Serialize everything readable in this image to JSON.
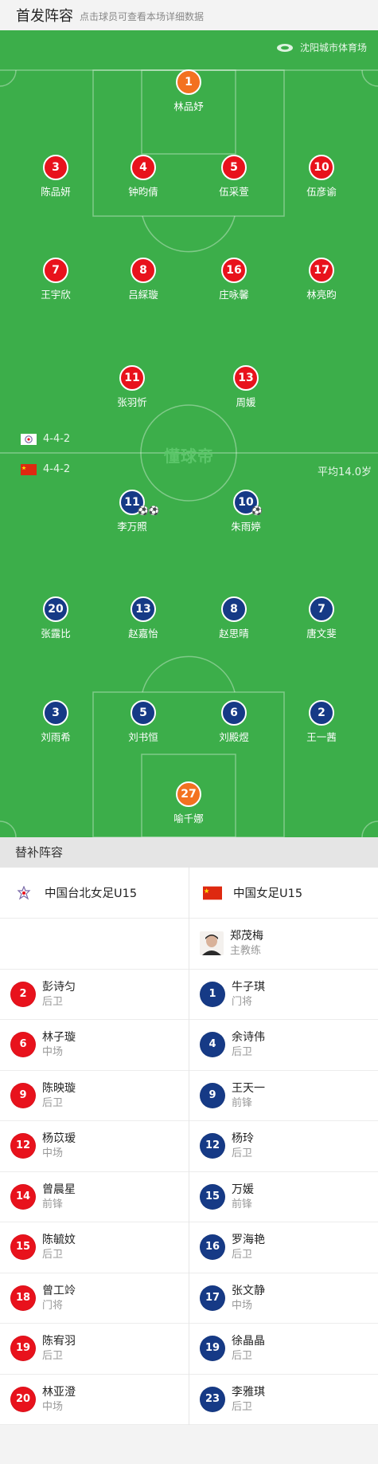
{
  "header": {
    "title": "首发阵容",
    "hint": "点击球员可查看本场详细数据"
  },
  "pitch": {
    "stadium": "沈阳城市体育场",
    "watermark": "懂球帝",
    "home_formation": "4-4-2",
    "away_formation": "4-4-2",
    "avg_age": "平均14.0岁"
  },
  "home_lineup": [
    {
      "number": "1",
      "name": "林品妤"
    },
    {
      "number": "3",
      "name": "陈品妍"
    },
    {
      "number": "4",
      "name": "钟昀倩"
    },
    {
      "number": "5",
      "name": "伍采萱"
    },
    {
      "number": "10",
      "name": "伍彦谕"
    },
    {
      "number": "7",
      "name": "王宇欣"
    },
    {
      "number": "8",
      "name": "吕綵璇"
    },
    {
      "number": "16",
      "name": "庄咏馨"
    },
    {
      "number": "17",
      "name": "林亮昀"
    },
    {
      "number": "11",
      "name": "张羽忻"
    },
    {
      "number": "13",
      "name": "周媛"
    }
  ],
  "away_lineup": [
    {
      "number": "11",
      "name": "李万照",
      "goals": "⚽⚽"
    },
    {
      "number": "10",
      "name": "朱雨婷",
      "goals": "⚽"
    },
    {
      "number": "20",
      "name": "张露比"
    },
    {
      "number": "13",
      "name": "赵嘉怡"
    },
    {
      "number": "8",
      "name": "赵思晴"
    },
    {
      "number": "7",
      "name": "唐文斐"
    },
    {
      "number": "3",
      "name": "刘雨希"
    },
    {
      "number": "5",
      "name": "刘书恒"
    },
    {
      "number": "6",
      "name": "刘殿煜"
    },
    {
      "number": "2",
      "name": "王一茜"
    },
    {
      "number": "27",
      "name": "喻千娜"
    }
  ],
  "subs": {
    "title": "替补阵容",
    "home_team": "中国台北女足U15",
    "away_team": "中国女足U15",
    "coach": {
      "name": "郑茂梅",
      "role": "主教练"
    },
    "home": [
      {
        "number": "2",
        "name": "彭诗匀",
        "pos": "后卫"
      },
      {
        "number": "6",
        "name": "林子璇",
        "pos": "中场"
      },
      {
        "number": "9",
        "name": "陈映璇",
        "pos": "后卫"
      },
      {
        "number": "12",
        "name": "杨苡瑷",
        "pos": "中场"
      },
      {
        "number": "14",
        "name": "曾晨星",
        "pos": "前锋"
      },
      {
        "number": "15",
        "name": "陈毓妏",
        "pos": "后卫"
      },
      {
        "number": "18",
        "name": "曾工竛",
        "pos": "门将"
      },
      {
        "number": "19",
        "name": "陈宥羽",
        "pos": "后卫"
      },
      {
        "number": "20",
        "name": "林亚澄",
        "pos": "中场"
      }
    ],
    "away": [
      {
        "number": "1",
        "name": "牛子琪",
        "pos": "门将"
      },
      {
        "number": "4",
        "name": "余诗伟",
        "pos": "后卫"
      },
      {
        "number": "9",
        "name": "王天一",
        "pos": "前锋"
      },
      {
        "number": "12",
        "name": "杨玲",
        "pos": "后卫"
      },
      {
        "number": "15",
        "name": "万媛",
        "pos": "前锋"
      },
      {
        "number": "16",
        "name": "罗海艳",
        "pos": "后卫"
      },
      {
        "number": "17",
        "name": "张文静",
        "pos": "中场"
      },
      {
        "number": "19",
        "name": "徐晶晶",
        "pos": "后卫"
      },
      {
        "number": "23",
        "name": "李雅琪",
        "pos": "后卫"
      }
    ]
  },
  "colors": {
    "pitch": "#3cae4a",
    "home": "#e8121c",
    "away": "#163a86",
    "keeper": "#f37120"
  }
}
